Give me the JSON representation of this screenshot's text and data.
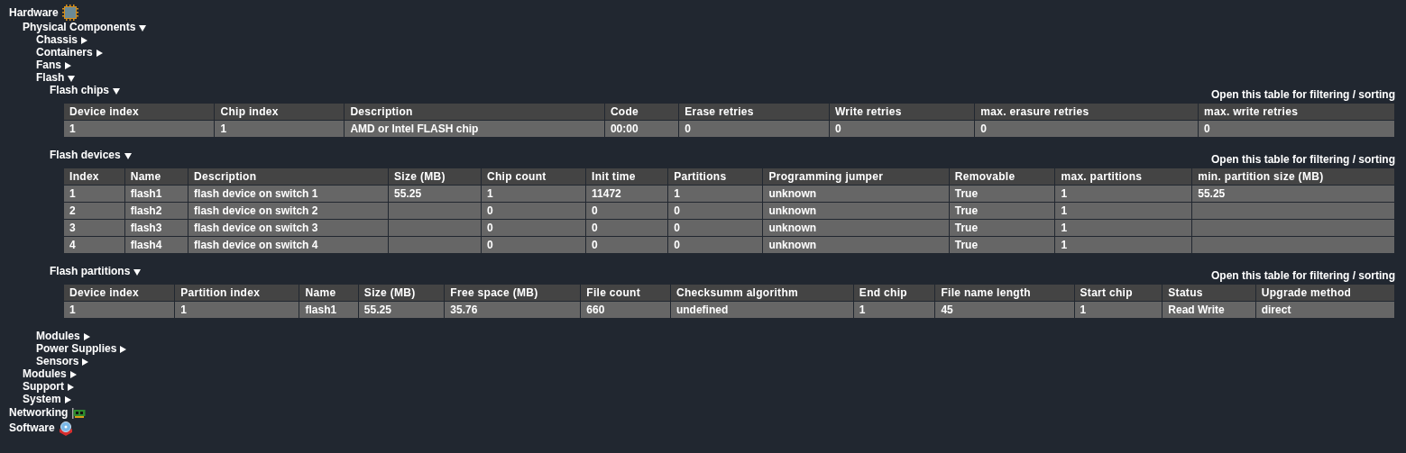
{
  "tree": [
    {
      "label": "Hardware",
      "children": [
        {
          "label": "Physical Components",
          "expanded": true,
          "children": [
            {
              "label": "Chassis",
              "expanded": false
            },
            {
              "label": "Containers",
              "expanded": false
            },
            {
              "label": "Fans",
              "expanded": false
            },
            {
              "label": "Flash",
              "expanded": true,
              "children": [
                {
                  "label": "Flash chips",
                  "expanded": true,
                  "table": {
                    "link": "Open this table for filtering / sorting",
                    "columns": [
                      "Device index",
                      "Chip index",
                      "Description",
                      "Code",
                      "Erase retries",
                      "Write retries",
                      "max. erasure retries",
                      "max. write retries"
                    ],
                    "rows": [
                      [
                        "1",
                        "1",
                        "AMD or Intel FLASH chip",
                        "00:00",
                        "0",
                        "0",
                        "0",
                        "0"
                      ]
                    ]
                  }
                },
                {
                  "label": "Flash devices",
                  "expanded": true,
                  "table": {
                    "link": "Open this table for filtering / sorting",
                    "columns": [
                      "Index",
                      "Name",
                      "Description",
                      "Size (MB)",
                      "Chip count",
                      "Init time",
                      "Partitions",
                      "Programming jumper",
                      "Removable",
                      "max. partitions",
                      "min. partition size (MB)"
                    ],
                    "rows": [
                      [
                        "1",
                        "flash1",
                        "flash device on switch 1",
                        "55.25",
                        "1",
                        "11472",
                        "1",
                        "unknown",
                        "True",
                        "1",
                        "55.25"
                      ],
                      [
                        "2",
                        "flash2",
                        "flash device on switch 2",
                        "",
                        "0",
                        "0",
                        "0",
                        "unknown",
                        "True",
                        "1",
                        ""
                      ],
                      [
                        "3",
                        "flash3",
                        "flash device on switch 3",
                        "",
                        "0",
                        "0",
                        "0",
                        "unknown",
                        "True",
                        "1",
                        ""
                      ],
                      [
                        "4",
                        "flash4",
                        "flash device on switch 4",
                        "",
                        "0",
                        "0",
                        "0",
                        "unknown",
                        "True",
                        "1",
                        ""
                      ]
                    ]
                  }
                },
                {
                  "label": "Flash partitions",
                  "expanded": true,
                  "table": {
                    "link": "Open this table for filtering / sorting",
                    "columns": [
                      "Device index",
                      "Partition index",
                      "Name",
                      "Size (MB)",
                      "Free space (MB)",
                      "File count",
                      "Checksumm algorithm",
                      "End chip",
                      "File name length",
                      "Start chip",
                      "Status",
                      "Upgrade method"
                    ],
                    "rows": [
                      [
                        "1",
                        "1",
                        "flash1",
                        "55.25",
                        "35.76",
                        "660",
                        "undefined",
                        "1",
                        "45",
                        "1",
                        "Read Write",
                        "direct"
                      ]
                    ]
                  }
                }
              ]
            },
            {
              "label": "Modules",
              "expanded": false
            },
            {
              "label": "Power Supplies",
              "expanded": false
            },
            {
              "label": "Sensors",
              "expanded": false
            }
          ]
        },
        {
          "label": "Modules",
          "expanded": false
        },
        {
          "label": "Support",
          "expanded": false
        },
        {
          "label": "System",
          "expanded": false
        }
      ]
    },
    {
      "label": "Networking"
    },
    {
      "label": "Software"
    }
  ]
}
